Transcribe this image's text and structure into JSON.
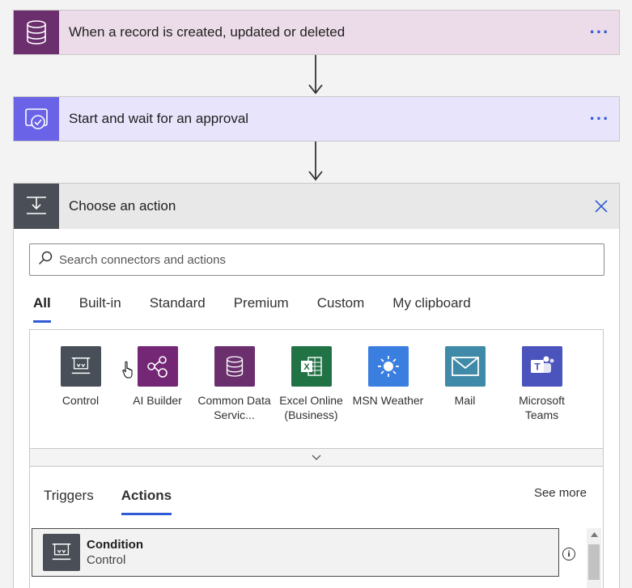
{
  "flow": {
    "steps": [
      {
        "title": "When a record is created, updated or deleted",
        "menu": "···",
        "icon": "database-icon",
        "color": "#6b2f6e"
      },
      {
        "title": "Start and wait for an approval",
        "menu": "···",
        "icon": "approval-icon",
        "color": "#6a63e8"
      }
    ]
  },
  "panel": {
    "title": "Choose an action",
    "icon": "control-icon",
    "search": {
      "placeholder": "Search connectors and actions",
      "value": ""
    },
    "tabs": [
      {
        "label": "All",
        "active": true
      },
      {
        "label": "Built-in",
        "active": false
      },
      {
        "label": "Standard",
        "active": false
      },
      {
        "label": "Premium",
        "active": false
      },
      {
        "label": "Custom",
        "active": false
      },
      {
        "label": "My clipboard",
        "active": false
      }
    ],
    "connectors": [
      {
        "label": "Control",
        "color": "#484f58",
        "icon": "control-icon"
      },
      {
        "label": "AI Builder",
        "color": "#742774",
        "icon": "ai-builder-icon"
      },
      {
        "label": "Common Data Servic...",
        "color": "#6b2f6e",
        "icon": "database-icon"
      },
      {
        "label": "Excel Online (Business)",
        "color": "#217346",
        "icon": "excel-icon"
      },
      {
        "label": "MSN Weather",
        "color": "#3a7ee0",
        "icon": "sun-icon"
      },
      {
        "label": "Mail",
        "color": "#3f8aa8",
        "icon": "mail-icon"
      },
      {
        "label": "Microsoft Teams",
        "color": "#4b53bc",
        "icon": "teams-icon"
      }
    ],
    "result_tabs": [
      {
        "label": "Triggers",
        "active": false
      },
      {
        "label": "Actions",
        "active": true
      }
    ],
    "see_more": "See more",
    "actions": [
      {
        "name": "Condition",
        "connector": "Control",
        "icon": "control-icon"
      }
    ]
  }
}
